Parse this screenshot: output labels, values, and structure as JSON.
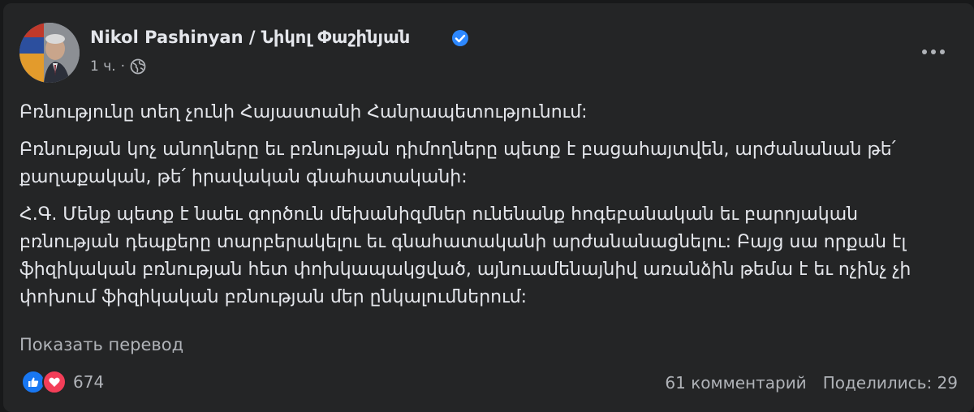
{
  "post": {
    "author": "Nikol Pashinyan / Նիկոլ Փաշինյան",
    "time": "1 ч.",
    "separator": "·",
    "paragraphs": [
      "Բռնությունը տեղ չունի Հայաստանի Հանրապետությունում:",
      "Բռնության կոչ անողները եւ բռնության դիմողները պետք է բացահայտվեն, արժանանան թե՛ քաղաքական, թե՛ իրավական գնահատականի:",
      "Հ.Գ. Մենք պետք է նաեւ գործուն մեխանիզմներ ունենանք հոգեբանական եւ բարոյական բռնության դեպքերը տարբերակելու եւ գնահատականի արժանանացնելու: Բայց սա որքան էլ ֆիզիկական բռնության հետ փոխկապակցված, այնուամենայնիվ առանձին թեմա է եւ ոչինչ չի փոխում ֆիզիկական բռնության մեր ընկալումներում:"
    ],
    "translate_label": "Показать перевод",
    "reaction_count": "674",
    "comments_label": "61 комментарий",
    "shares_label": "Поделились: 29"
  },
  "icons": {
    "verified": "verified-badge-icon",
    "privacy": "globe-icon",
    "menu": "more-options-icon",
    "reactions": [
      "like-icon",
      "love-icon"
    ]
  },
  "colors": {
    "background": "#18191a",
    "card": "#242526",
    "primary_text": "#e4e6eb",
    "secondary_text": "#b0b3b8",
    "verified": "#2d88ff",
    "like": "#1877f2",
    "love": "#f33e58"
  }
}
